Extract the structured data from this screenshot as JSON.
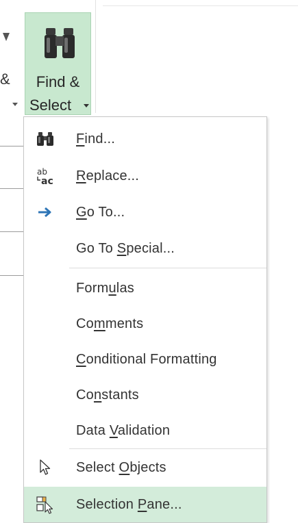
{
  "ribbon": {
    "prev_group_label": "&",
    "find_select": {
      "label_line1": "Find &",
      "label_line2": "Select",
      "icon": "binoculars-icon"
    }
  },
  "menu": {
    "items": [
      {
        "label": "Find...",
        "accel": "F",
        "icon": "binoculars-icon"
      },
      {
        "label": "Replace...",
        "accel": "R",
        "icon": "replace-icon"
      },
      {
        "label": "Go To...",
        "accel": "G",
        "icon": "arrow-right-icon"
      },
      {
        "label": "Go To Special...",
        "accel": "S",
        "icon": ""
      },
      {
        "label": "Formulas",
        "accel": "u",
        "icon": ""
      },
      {
        "label": "Comments",
        "accel": "m",
        "icon": ""
      },
      {
        "label": "Conditional Formatting",
        "accel": "C",
        "icon": ""
      },
      {
        "label": "Constants",
        "accel": "n",
        "icon": ""
      },
      {
        "label": "Data Validation",
        "accel": "V",
        "icon": ""
      },
      {
        "label": "Select Objects",
        "accel": "O",
        "icon": "cursor-arrow-icon"
      },
      {
        "label": "Selection Pane...",
        "accel": "P",
        "icon": "selection-pane-icon"
      }
    ],
    "highlighted_item": "Selection Pane...",
    "colors": {
      "highlight": "#d3ecda",
      "button_active": "#c8e8cf",
      "arrow_blue": "#2e75b6"
    }
  }
}
